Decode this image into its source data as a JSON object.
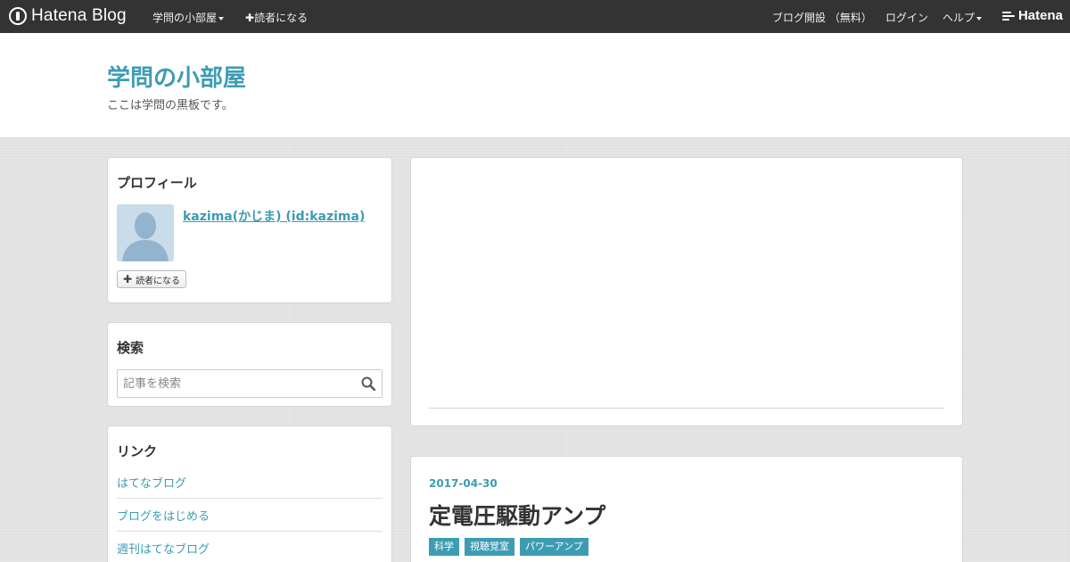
{
  "topbar": {
    "brand": "Hatena Blog",
    "blog_menu": "学問の小部屋",
    "subscribe": "読者になる",
    "create_blog": "ブログ開設 （無料）",
    "login": "ログイン",
    "help": "ヘルプ",
    "hatena": "Hatena"
  },
  "header": {
    "title": "学問の小部屋",
    "description": "ここは学問の黒板です。"
  },
  "sidebar": {
    "profile": {
      "title": "プロフィール",
      "name": "kazima(かじま) (id:kazima)",
      "subscribe_label": "読者になる"
    },
    "search": {
      "title": "検索",
      "placeholder": "記事を検索"
    },
    "links": {
      "title": "リンク",
      "items": [
        "はてなブログ",
        "ブログをはじめる",
        "週刊はてなブログ"
      ]
    }
  },
  "entry": {
    "date": "2017-04-30",
    "title": "定電圧駆動アンプ",
    "tags": [
      "科学",
      "視聴覚室",
      "パワーアンプ"
    ]
  },
  "colors": {
    "accent": "#3d9cb3",
    "topbar": "#333333",
    "background": "#e6e6e6"
  }
}
